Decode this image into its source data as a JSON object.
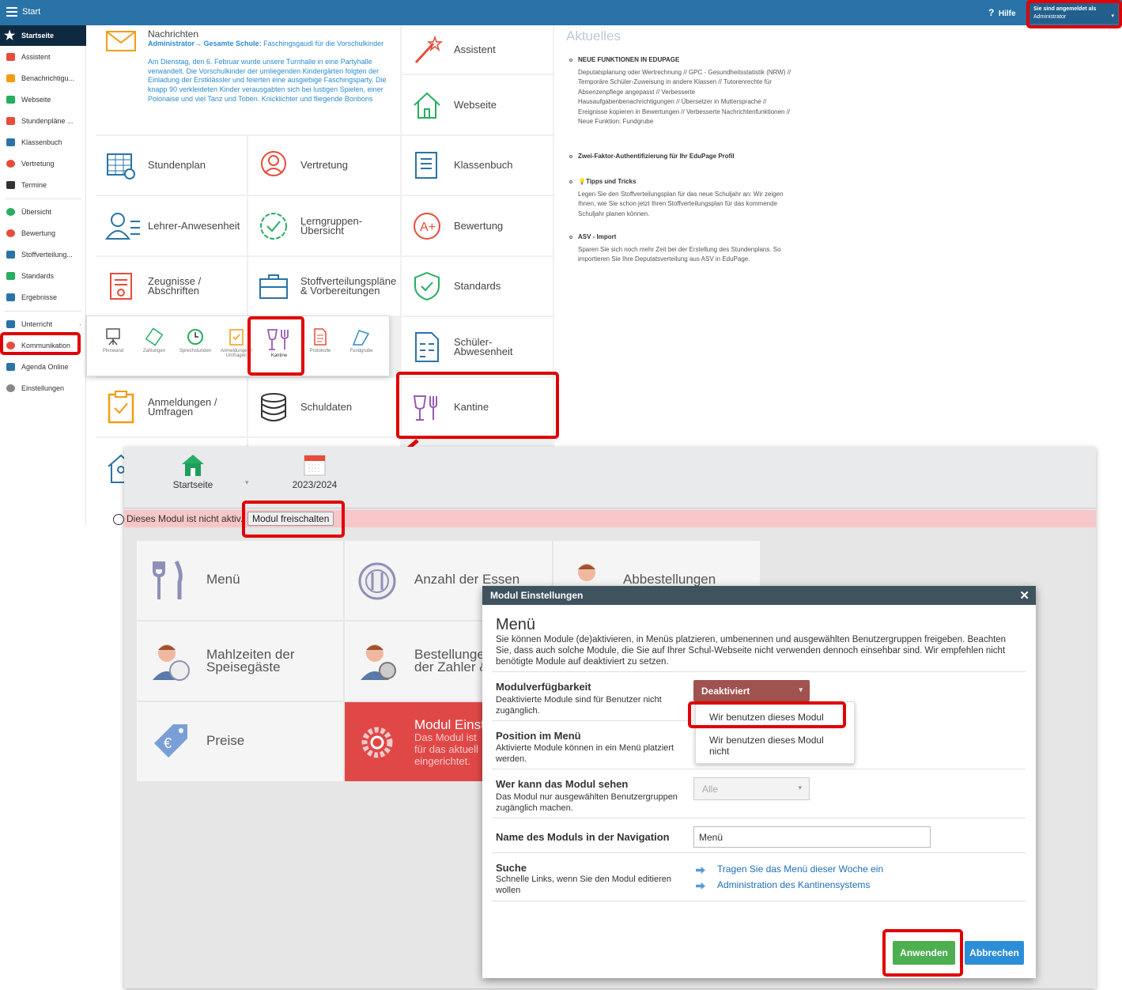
{
  "topbar": {
    "title": "Start",
    "help": "Hilfe",
    "user_line1": "Sie sind angemeldet als",
    "user_line2": "Administrator"
  },
  "sidebar": {
    "items": [
      {
        "label": "Startseite",
        "color": "#ffffff"
      },
      {
        "label": "Assistent",
        "color": "#e74c3c"
      },
      {
        "label": "Benachrichtigu...",
        "color": "#f39c12"
      },
      {
        "label": "Webseite",
        "color": "#27ae60"
      },
      {
        "label": "Stundenpläne ...",
        "color": "#e74c3c"
      },
      {
        "label": "Klassenbuch",
        "color": "#2a73a8"
      },
      {
        "label": "Vertretung",
        "color": "#e74c3c"
      },
      {
        "label": "Termine",
        "color": "#333333"
      },
      {
        "label": "Übersicht",
        "color": "#27ae60"
      },
      {
        "label": "Bewertung",
        "color": "#e74c3c"
      },
      {
        "label": "Stoffverteilung...",
        "color": "#2a73a8"
      },
      {
        "label": "Standards",
        "color": "#27ae60"
      },
      {
        "label": "Ergebnisse",
        "color": "#2a73a8"
      },
      {
        "label": "Unterricht",
        "color": "#2a73a8"
      },
      {
        "label": "Kommunikation",
        "color": "#e74c3c"
      },
      {
        "label": "Agenda Online",
        "color": "#2a73a8"
      },
      {
        "label": "Einstellungen",
        "color": "#888888"
      }
    ]
  },
  "messages": {
    "title": "Nachrichten",
    "sender": "Administrator",
    "recipient": "Gesamte Schule:",
    "subject": "Faschingsgaudi für die Vorschulkinder",
    "body": "Am Dienstag, den 6. Februar wurde unsere Turnhalle in eine Partyhalle verwandelt. Die Vorschulkinder der umliegenden Kindergärten folgten der Einladung der Erstklässler und feierten eine ausgiebige Faschingsparty. Die knapp 90 verkleideten Kinder verausgabten sich bei lustigen Spielen, einer Polonaise und viel Tanz und Toben. Knicklichter und fliegende Bonbons sorgten dabei für die"
  },
  "tiles": {
    "assistent": "Assistent",
    "webseite": "Webseite",
    "stundenplan": "Stundenplan",
    "vertretung": "Vertretung",
    "klassenbuch": "Klassenbuch",
    "lehrer": "Lehrer-Anwesenheit",
    "lern1": "Lerngruppen-",
    "lern2": "Übersicht",
    "bewertung": "Bewertung",
    "zeug1": "Zeugnisse /",
    "zeug2": "Abschriften",
    "stoff1": "Stoffverteilungspläne",
    "stoff2": "& Vorbereitungen",
    "standards": "Standards",
    "sch1": "Schüler-",
    "sch2": "Abwesenheit",
    "anm1": "Anmeldungen /",
    "anm2": "Umfragen",
    "schuldaten": "Schuldaten",
    "kantine": "Kantine"
  },
  "popup": [
    "Pinnwand",
    "Zahlungen",
    "Sprechstunden",
    "Anmeldungen / Umfragen",
    "Kantine",
    "Protokolle",
    "Fundgrube"
  ],
  "news": {
    "title": "Aktuelles",
    "items": [
      {
        "title": "NEUE FUNKTIONEN IN EDUPAGE",
        "text": "Deputatsplanung oder Wertrechnung // GPC - Gesundheitsstatistik (NRW) // Temporäre Schüler-Zuweisung in andere Klassen // Tutorenrechte für Absenzenpflege angepasst // Verbesserte Hausaufgabenbenachrichtigungen // Übersetzer in Muttersprache // Ereignisse kopieren in Bewertungen // Verbesserte Nachrichtenfunktionen // Neue Funktion: Fundgrube"
      },
      {
        "title": "Zwei-Faktor-Authentifizierung für Ihr EduPage Profil",
        "text": ""
      },
      {
        "title": "Tipps und Tricks",
        "text": "Legen Sie den Stoffverteilungsplan für das neue Schuljahr an: Wir zeigen Ihnen, wie Sie schon jetzt Ihren Stoffverteilungsplan für das kommende Schuljahr planen können."
      },
      {
        "title": "ASV - Import",
        "text": "Sparen Sie sich noch mehr Zeit bei der Erstellung des Stundenplans. So importieren Sie Ihre Deputatsverteilung aus ASV in EduPage."
      }
    ]
  },
  "panel": {
    "home": "Startseite",
    "year": "2023/2024",
    "notice": "Dieses Modul ist nicht aktiv.",
    "unlock": "Modul freischalten",
    "tiles": {
      "menu": "Menü",
      "anzahl": "Anzahl der Essen",
      "abbest": "Abbestellungen",
      "mahl1": "Mahlzeiten der",
      "mahl2": "Speisegäste",
      "best1": "Bestellungen",
      "best2": "der Zahler &",
      "preise": "Preise",
      "einst": "Modul Einst",
      "einst_sub1": "Das Modul ist",
      "einst_sub2": "für das aktuell",
      "einst_sub3": "eingerichtet."
    }
  },
  "dialog": {
    "header": "Modul Einstellungen",
    "title": "Menü",
    "intro": "Sie können Module (de)aktivieren, in Menüs platzieren, umbenennen und ausgewählten Benutzergruppen freigeben. Beachten Sie, dass auch solche Module, die Sie auf Ihrer Schul-Webseite nicht verwenden dennoch einsehbar sind. Wir empfehlen nicht benötigte Module auf deaktiviert zu setzen.",
    "avail_t": "Modulverfügbarkeit",
    "avail_d": "Deaktivierte Module sind für Benutzer nicht zugänglich.",
    "avail_val": "Deaktiviert",
    "opt1": "Wir benutzen dieses Modul",
    "opt2": "Wir benutzen dieses Modul nicht",
    "pos_t": "Position im Menü",
    "pos_d": "Aktivierte Module können in ein Menü platziert werden.",
    "who_t": "Wer kann das Modul sehen",
    "who_d": "Das Modul nur ausgewählten Benutzergruppen zugänglich machen.",
    "who_val": "Alle",
    "name_t": "Name des Moduls in der Navigation",
    "name_val": "Menü",
    "search_t": "Suche",
    "search_d": "Schnelle Links, wenn Sie den Modul editieren wollen",
    "link1": "Tragen Sie das Menü dieser Woche ein",
    "link2": "Administration des Kantinensystems",
    "apply": "Anwenden",
    "cancel": "Abbrechen"
  }
}
